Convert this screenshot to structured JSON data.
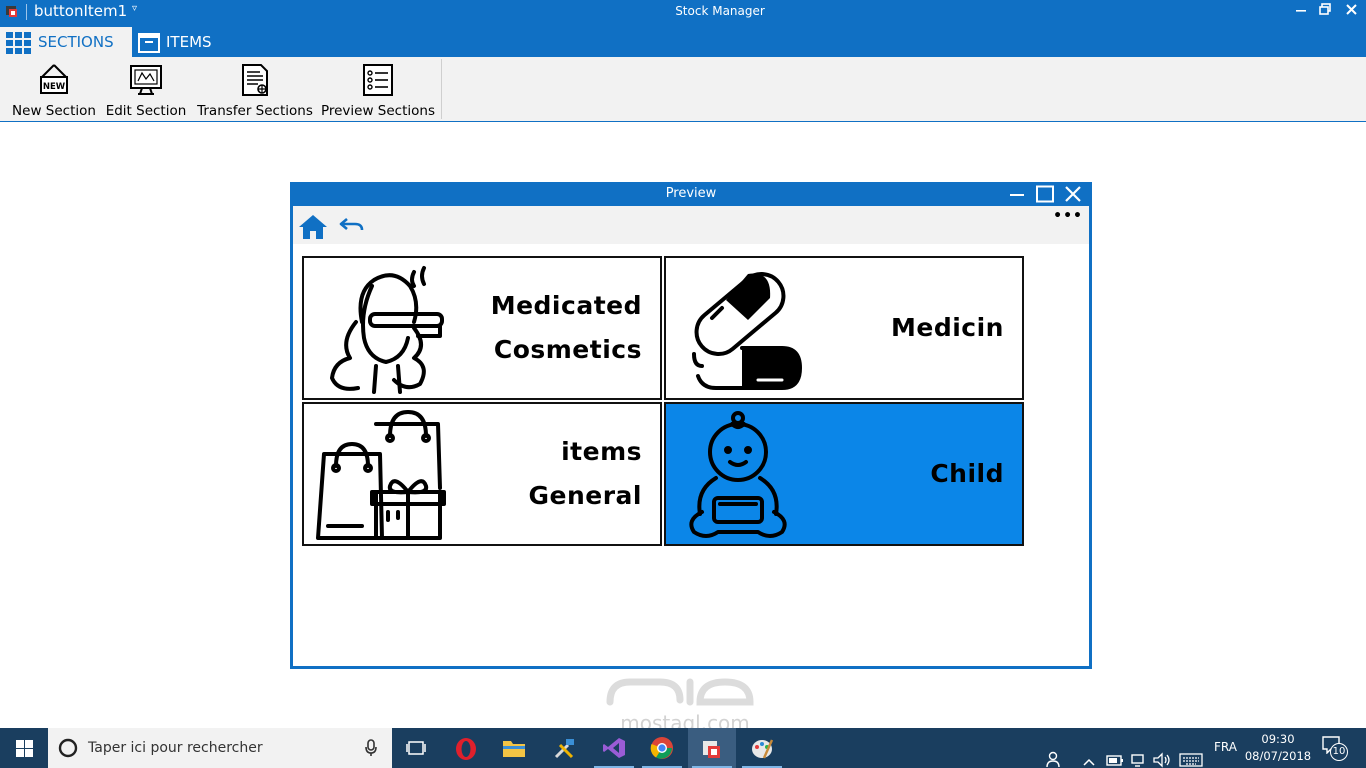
{
  "titlebar": {
    "quick_access_label": "buttonItem1",
    "window_title": "Stock Manager"
  },
  "ribbon": {
    "tabs": [
      {
        "label": "SECTIONS",
        "active": true
      },
      {
        "label": "ITEMS",
        "active": false
      }
    ],
    "buttons": [
      {
        "label": "New Section",
        "icon": "new-sign-icon"
      },
      {
        "label": "Edit Section",
        "icon": "edit-monitor-icon"
      },
      {
        "label": "Transfer Sections",
        "icon": "transfer-document-icon"
      },
      {
        "label": "Preview Sections",
        "icon": "preview-list-icon"
      }
    ]
  },
  "preview": {
    "title": "Preview",
    "more_label": "•••",
    "tiles": [
      {
        "label": "Medicated Cosmetics",
        "icon": "woman-cosmetics-icon",
        "selected": false
      },
      {
        "label": "Medicin",
        "icon": "pill-capsule-icon",
        "selected": false
      },
      {
        "label": "items General",
        "icon": "shopping-bags-gift-icon",
        "selected": false
      },
      {
        "label": "Child",
        "icon": "baby-icon",
        "selected": true
      }
    ]
  },
  "watermark": {
    "text": "mostaql.com"
  },
  "taskbar": {
    "search_placeholder": "Taper ici pour rechercher",
    "language": "FRA",
    "time": "09:30",
    "date": "08/07/2018",
    "notification_count": "10"
  },
  "colors": {
    "accent": "#1070c4",
    "selected_tile": "#0b86e8",
    "taskbar": "#1a3e5f"
  }
}
